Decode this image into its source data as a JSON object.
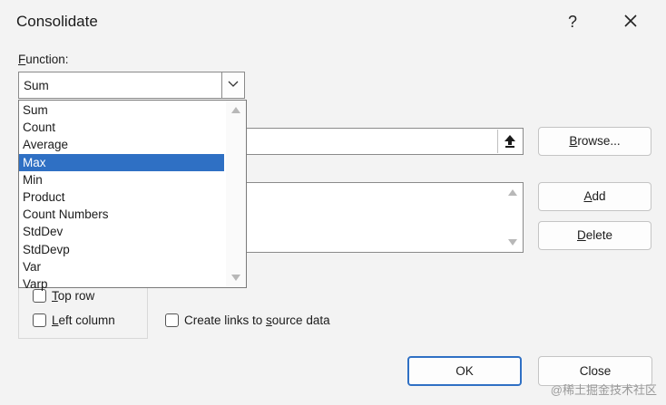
{
  "dialog": {
    "title": "Consolidate",
    "help_label": "?",
    "function_label": {
      "prefix": "F",
      "rest": "unction:"
    },
    "function_selected": "Sum",
    "function_options": [
      "Sum",
      "Count",
      "Average",
      "Max",
      "Min",
      "Product",
      "Count Numbers",
      "StdDev",
      "StdDevp",
      "Var",
      "Varp"
    ],
    "highlighted_option": "Max",
    "browse_label": {
      "prefix": "B",
      "rest": "rowse..."
    },
    "add_label": {
      "prefix": "A",
      "rest": "dd"
    },
    "delete_label": {
      "prefix": "D",
      "rest": "elete"
    },
    "use_labels": {
      "top_row": {
        "prefix": "T",
        "rest": "op row",
        "checked": false
      },
      "left_column": {
        "prefix": "L",
        "rest": "eft column",
        "checked": false
      }
    },
    "create_links": {
      "before": "Create links to ",
      "underlined": "s",
      "after": "ource data",
      "checked": false
    },
    "ok_label": "OK",
    "close_label": "Close"
  },
  "watermark": "@稀土掘金技术社区",
  "colors": {
    "accent": "#2f70c4",
    "dialog_bg": "#f3f3f3"
  }
}
